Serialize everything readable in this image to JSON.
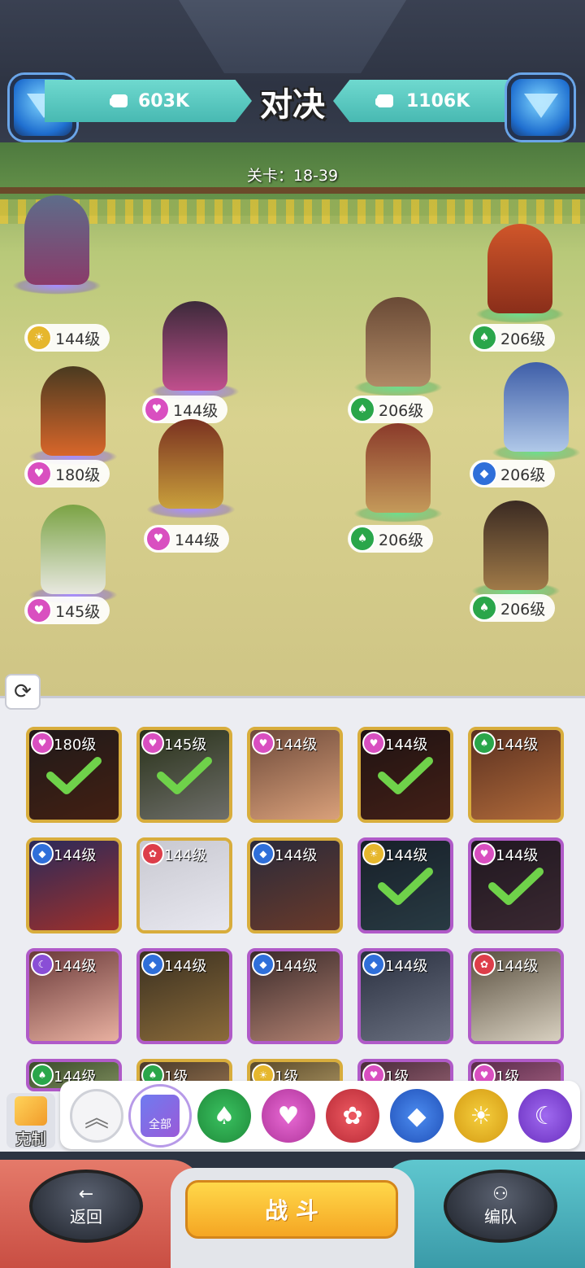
{
  "header": {
    "title": "对决",
    "left_power": "603K",
    "right_power": "1106K",
    "stage": "关卡：18-39"
  },
  "colors": {
    "sun": "#e6b72d",
    "heart": "#d94fc0",
    "leaf": "#2aa64a",
    "diamond": "#2f6fd9",
    "moon": "#8a4ed6",
    "flower": "#dd3e4a"
  },
  "battlefield": {
    "ally_units": [
      {
        "level": "144级",
        "faction": "sun-icon"
      },
      {
        "level": "144级",
        "faction": "heart-icon"
      },
      {
        "level": "180级",
        "faction": "heart-icon"
      },
      {
        "level": "144级",
        "faction": "heart-icon"
      },
      {
        "level": "145级",
        "faction": "heart-icon"
      }
    ],
    "enemy_units": [
      {
        "level": "206级",
        "faction": "leaf-icon"
      },
      {
        "level": "206级",
        "faction": "leaf-icon"
      },
      {
        "level": "206级",
        "faction": "diamond-icon"
      },
      {
        "level": "206级",
        "faction": "leaf-icon"
      },
      {
        "level": "206级",
        "faction": "leaf-icon"
      }
    ]
  },
  "roster": {
    "cards": [
      {
        "level": "180级",
        "faction": "heart-icon",
        "selected": true
      },
      {
        "level": "145级",
        "faction": "heart-icon",
        "selected": true
      },
      {
        "level": "144级",
        "faction": "heart-icon",
        "selected": false
      },
      {
        "level": "144级",
        "faction": "heart-icon",
        "selected": true
      },
      {
        "level": "144级",
        "faction": "leaf-icon",
        "selected": false
      },
      {
        "level": "144级",
        "faction": "diamond-icon",
        "selected": false
      },
      {
        "level": "144级",
        "faction": "flower-icon",
        "selected": false
      },
      {
        "level": "144级",
        "faction": "diamond-icon",
        "selected": false
      },
      {
        "level": "144级",
        "faction": "sun-icon",
        "selected": true
      },
      {
        "level": "144级",
        "faction": "heart-icon",
        "selected": true
      },
      {
        "level": "144级",
        "faction": "moon-icon",
        "selected": false
      },
      {
        "level": "144级",
        "faction": "diamond-icon",
        "selected": false
      },
      {
        "level": "144级",
        "faction": "diamond-icon",
        "selected": false
      },
      {
        "level": "144级",
        "faction": "diamond-icon",
        "selected": false
      },
      {
        "level": "144级",
        "faction": "flower-icon",
        "selected": false
      },
      {
        "level": "144级",
        "faction": "leaf-icon",
        "selected": false
      },
      {
        "level": "1级",
        "faction": "leaf-icon",
        "selected": false
      },
      {
        "level": "1级",
        "faction": "sun-icon",
        "selected": false
      },
      {
        "level": "1级",
        "faction": "heart-icon",
        "selected": false
      },
      {
        "level": "1级",
        "faction": "heart-icon",
        "selected": false
      }
    ]
  },
  "filters": {
    "counter_label": "克制",
    "all_label": "全部",
    "buttons": [
      "collapse-icon",
      "all-icon",
      "leaf-icon",
      "heart-icon",
      "flower-icon",
      "diamond-icon",
      "sun-icon",
      "moon-icon"
    ]
  },
  "controls": {
    "back_label": "返回",
    "fight_label": "战 斗",
    "formation_label": "编队"
  }
}
